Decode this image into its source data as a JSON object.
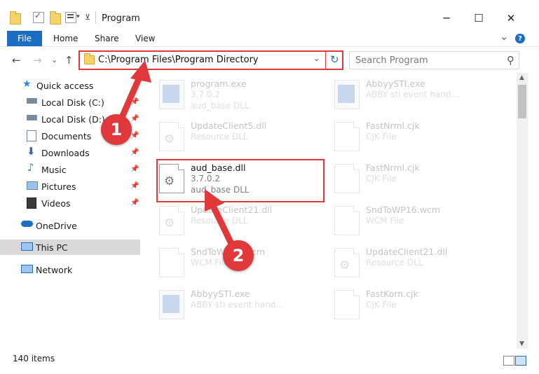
{
  "window": {
    "title": "Program",
    "minimize": "─",
    "maximize": "☐",
    "close": "✕"
  },
  "ribbon": {
    "file": "File",
    "home": "Home",
    "share": "Share",
    "view": "View",
    "expand_icon": "⌄",
    "help_icon": "?"
  },
  "nav": {
    "back": "←",
    "forward": "→",
    "recent": "⌄",
    "up": "↑"
  },
  "address": {
    "path": "C:\\Program Files\\Program Directory",
    "dropdown": "⌄",
    "refresh": "↻"
  },
  "search": {
    "placeholder": "Search Program",
    "icon": "⚲"
  },
  "sidebar": {
    "quick_access": "Quick access",
    "items": [
      {
        "label": "Local Disk (C:)"
      },
      {
        "label": "Local Disk (D:)"
      },
      {
        "label": "Documents"
      },
      {
        "label": "Downloads"
      },
      {
        "label": "Music"
      },
      {
        "label": "Pictures"
      },
      {
        "label": "Videos"
      }
    ],
    "onedrive": "OneDrive",
    "this_pc": "This PC",
    "network": "Network"
  },
  "files": {
    "left": [
      {
        "name": "program.exe",
        "line1": "3.7.0.2",
        "line2": "aud_base DLL",
        "icon": "exe-icon"
      },
      {
        "name": "UpdateClient5.dll",
        "line1": "Resource DLL",
        "line2": "",
        "icon": "dll-icon"
      },
      {
        "name": "aud_base.dll",
        "line1": "3.7.0.2",
        "line2": "aud_base DLL",
        "icon": "dll-icon"
      },
      {
        "name": "UpdateClient21.dll",
        "line1": "Resource DLL",
        "line2": "",
        "icon": "dll-icon"
      },
      {
        "name": "SndToWP16.wcm",
        "line1": "WCM File",
        "line2": "",
        "icon": "file-icon"
      },
      {
        "name": "AbbyySTI.exe",
        "line1": "ABBY sti event hand...",
        "line2": "",
        "icon": "exe-icon"
      }
    ],
    "right": [
      {
        "name": "AbbyySTI.exe",
        "line1": "ABBY sti event hand...",
        "icon": "exe-icon"
      },
      {
        "name": "FastNrml.cjk",
        "line1": "CJK File",
        "icon": "file-icon"
      },
      {
        "name": "FastNrml.cjk",
        "line1": "CJK File",
        "icon": "file-icon"
      },
      {
        "name": "SndToWP16.wcm",
        "line1": "WCM File",
        "icon": "file-icon"
      },
      {
        "name": "UpdateClient21.dll",
        "line1": "Resource DLL",
        "icon": "dll-icon"
      },
      {
        "name": "FastKorn.cjk",
        "line1": "CJK File",
        "icon": "file-icon"
      }
    ]
  },
  "status": {
    "item_count": "140 items"
  },
  "callouts": {
    "one": "1",
    "two": "2"
  },
  "colors": {
    "accent": "#1b6ec2",
    "callout_red": "#e0383b"
  }
}
